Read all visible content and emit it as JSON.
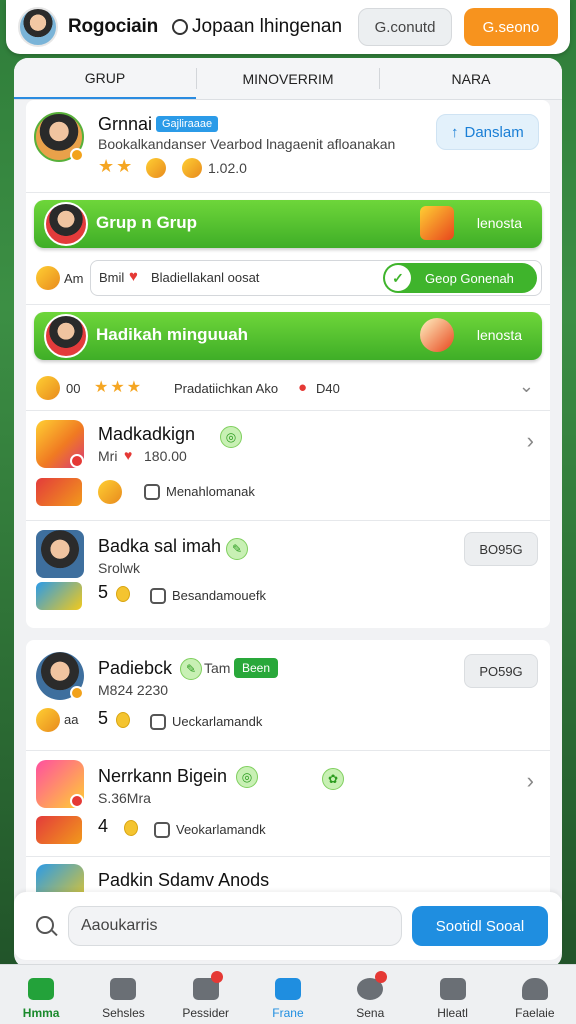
{
  "header": {
    "title": "Rogociain",
    "subtitle": "Jopaan lhingenan",
    "grey_button": "G.conutd",
    "orange_button": "G.seono"
  },
  "tabs": [
    "GRUP",
    "MINOVERRIM",
    "NARA"
  ],
  "profile": {
    "name": "Grnnai",
    "tag": "Gajliraaae",
    "description": "Bookalkandanser Vearbod lnagaenit afloanakan",
    "count": "1.02.0",
    "action": "Danslam"
  },
  "group_bar_1": {
    "title": "Grup n Grup",
    "right": "lenosta"
  },
  "input_row": {
    "prefix": "Am",
    "value": "Bmil",
    "text": "Bladiellakanl oosat",
    "toggle_label": "Geop Gonenah"
  },
  "group_bar_2": {
    "title": "Hadikah minguuah",
    "right": "lenosta"
  },
  "stars_row": {
    "prefix": "00",
    "text": "Pradatiichkan Ako",
    "count": "D40"
  },
  "items": [
    {
      "name": "Madkadkign",
      "meta_prefix": "Mri",
      "meta_value": "180.00",
      "footer": "Menahlomanak"
    },
    {
      "name": "Badka sal imah",
      "meta": "Srolwk",
      "count": "5",
      "footer": "Besandamouefk",
      "button": "BO95G"
    },
    {
      "name": "Padiebck",
      "name_extra": "Tam",
      "badge": "Been",
      "meta": "M824 2230",
      "count": "5",
      "prefix": "aa",
      "footer": "Ueckarlamandk",
      "button": "PO59G"
    },
    {
      "name": "Nerrkann Bigein",
      "meta": "S.36Mra",
      "count": "4",
      "footer": "Veokarlamandk"
    },
    {
      "name": "Padkin Sdamv Anods"
    }
  ],
  "search": {
    "value": "Aaoukarris",
    "button": "Sootidl Sooal"
  },
  "nav": [
    {
      "label": "Hmma"
    },
    {
      "label": "Sehsles"
    },
    {
      "label": "Pessider"
    },
    {
      "label": "Frane"
    },
    {
      "label": "Sena"
    },
    {
      "label": "Hleatl"
    },
    {
      "label": "Faelaie"
    }
  ],
  "colors": {
    "accent": "#1f8ee0",
    "green": "#3fae27",
    "orange": "#f7931e"
  }
}
